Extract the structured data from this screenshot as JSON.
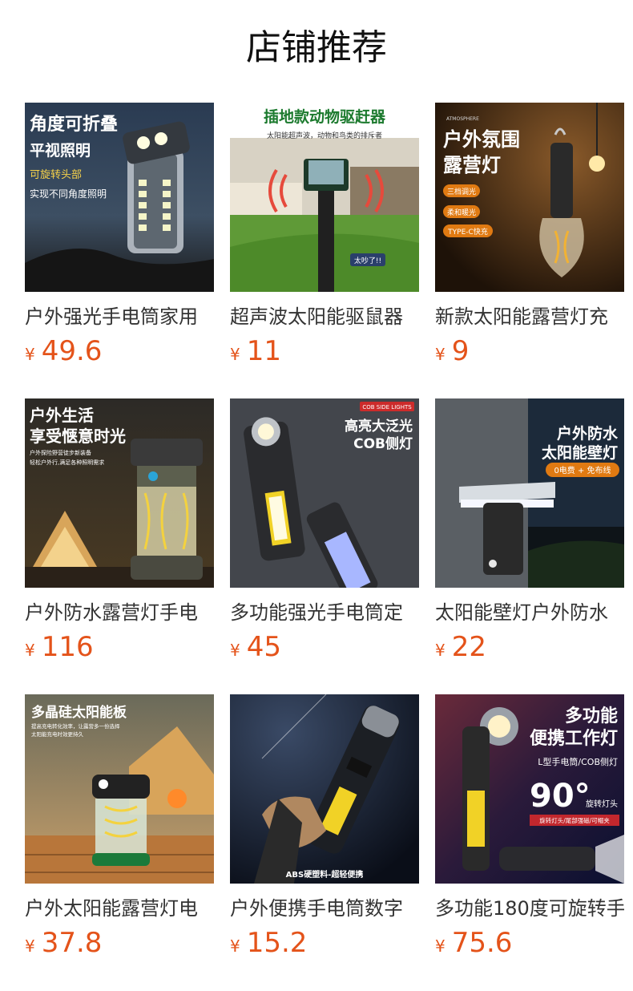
{
  "page": {
    "title": "店铺推荐"
  },
  "colors": {
    "price": "#e4531a",
    "text": "#333333"
  },
  "currency": "¥",
  "products": [
    {
      "name": "户外强光手电筒家用",
      "price": "49.6",
      "image": {
        "icon": "flashlight-icon",
        "headline1": "角度可折叠",
        "headline2": "平视照明",
        "tag": "可旋转头部",
        "sub": "实现不同角度照明"
      }
    },
    {
      "name": "超声波太阳能驱鼠器",
      "price": "11",
      "image": {
        "icon": "repeller-icon",
        "headline1": "插地款动物驱赶器",
        "sub": "太阳能超声波，动物和鸟类的排斥者",
        "tag": "太吵了!!"
      }
    },
    {
      "name": "新款太阳能露营灯充",
      "price": "9",
      "image": {
        "icon": "camping-bulb-icon",
        "top": "ATMOSPHERE",
        "headline1": "户外氛围",
        "headline2": "露营灯",
        "tags": [
          "三档调光",
          "柔和暖光",
          "TYPE-C快充"
        ]
      }
    },
    {
      "name": "户外防水露营灯手电",
      "price": "116",
      "image": {
        "icon": "lantern-icon",
        "headline1": "户外生活",
        "headline2": "享受惬意时光",
        "sub1": "户外探险野营徒步新装备",
        "sub2": "轻松户外行,满足各种照明需求"
      }
    },
    {
      "name": "多功能强光手电筒定",
      "price": "45",
      "image": {
        "icon": "cob-flashlight-icon",
        "badge": "COB SIDE LIGHTS",
        "headline1": "高亮大泛光",
        "headline2": "COB侧灯"
      }
    },
    {
      "name": "太阳能壁灯户外防水",
      "price": "22",
      "image": {
        "icon": "wall-lamp-icon",
        "headline1": "户外防水",
        "headline2": "太阳能壁灯",
        "tag": "0电费 + 免布线"
      }
    },
    {
      "name": "户外太阳能露营灯电",
      "price": "37.8",
      "image": {
        "icon": "solar-lantern-icon",
        "headline1": "多晶硅太阳能板",
        "sub1": "提高充电转化效率，让露营多一份选择",
        "sub2": "太阳能充电时效更持久"
      }
    },
    {
      "name": "户外便携手电筒数字",
      "price": "15.2",
      "image": {
        "icon": "handheld-flashlight-icon",
        "caption": "ABS硬塑料-超轻便携"
      }
    },
    {
      "name": "多功能180度可旋转手",
      "price": "75.6",
      "image": {
        "icon": "rotating-worklight-icon",
        "headline1": "多功能",
        "headline2": "便携工作灯",
        "sub": "L型手电筒/COB侧灯",
        "big": "90°",
        "big_sub": "旋转灯头",
        "tag": "旋转灯头/尾部强磁/可帽夹"
      }
    }
  ]
}
